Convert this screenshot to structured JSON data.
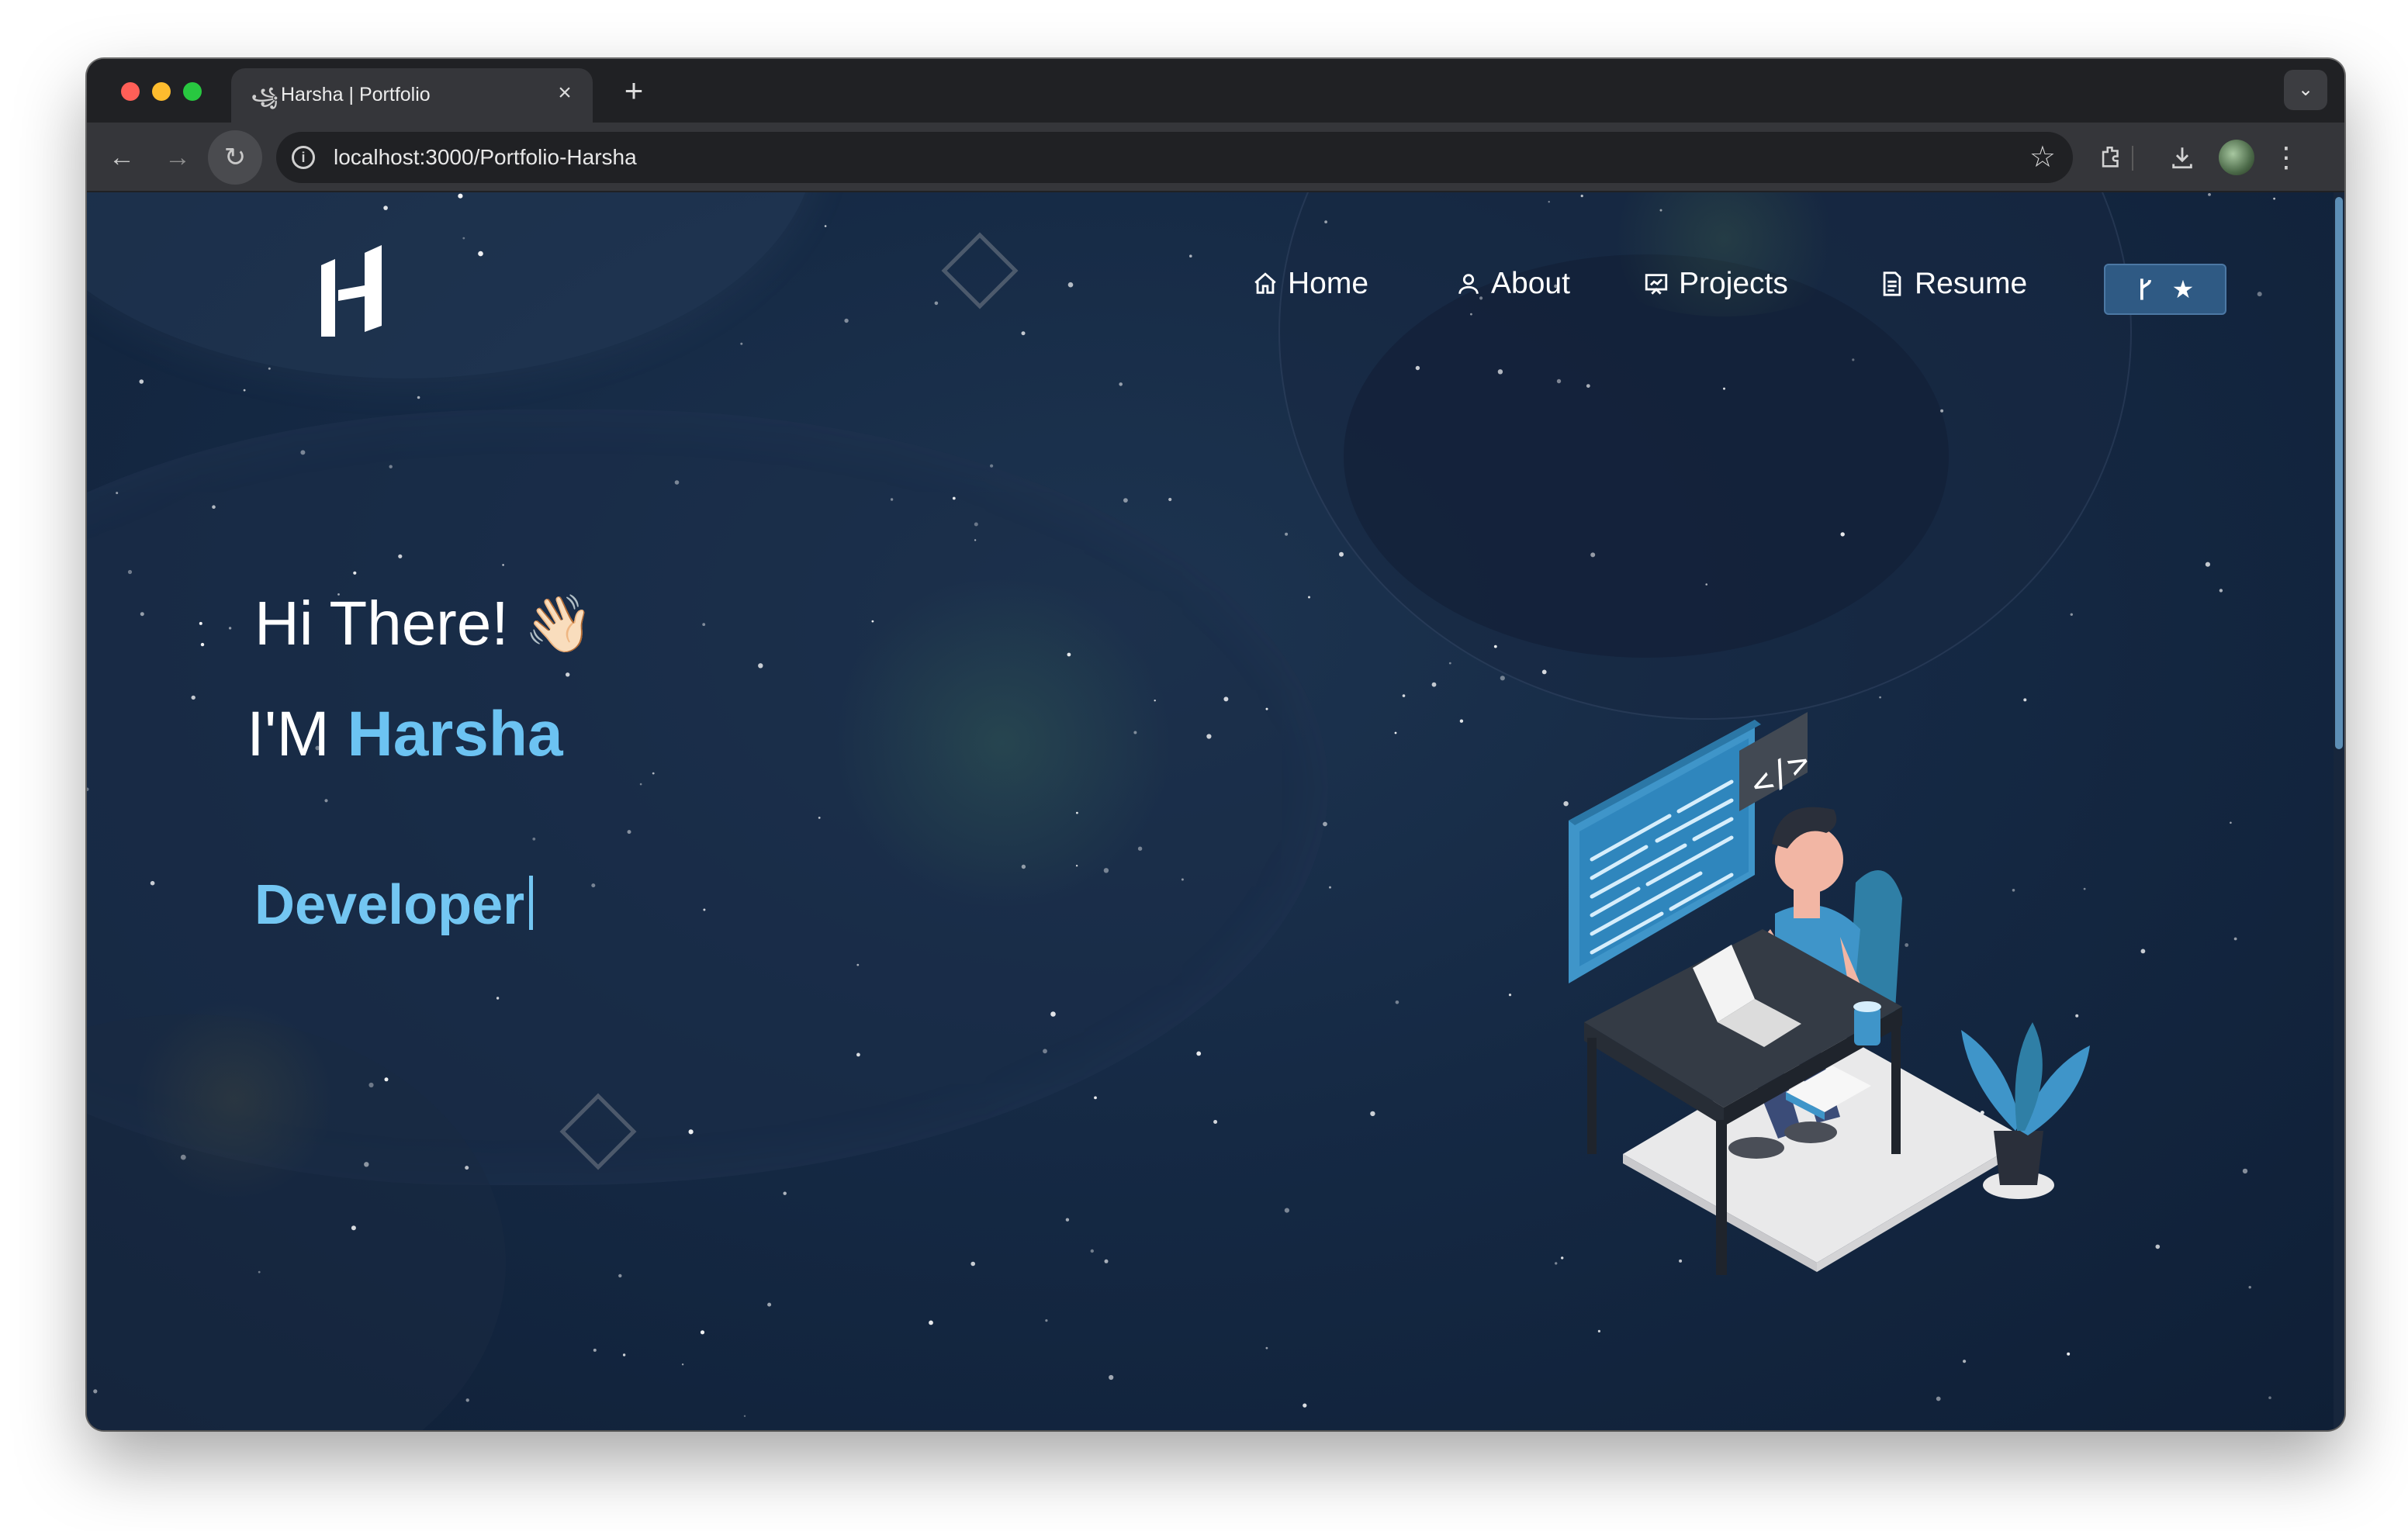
{
  "browser": {
    "tab_title": "Harsha | Portfolio",
    "tab_favicon": "꧁",
    "url": "localhost:3000/Portfolio-Harsha"
  },
  "site": {
    "nav": [
      {
        "label": "Home",
        "icon": "home-icon"
      },
      {
        "label": "About",
        "icon": "user-icon"
      },
      {
        "label": "Projects",
        "icon": "projects-icon"
      },
      {
        "label": "Resume",
        "icon": "document-icon"
      }
    ],
    "github_button_icons": [
      "git-fork-icon",
      "star-icon"
    ]
  },
  "hero": {
    "greeting": "Hi There!",
    "wave": "👋🏻",
    "intro_prefix": "I'M ",
    "name": "Harsha",
    "role": "Developer"
  },
  "colors": {
    "background": "#152944",
    "accent": "#6cc3f2",
    "button": "#2f5a84"
  }
}
